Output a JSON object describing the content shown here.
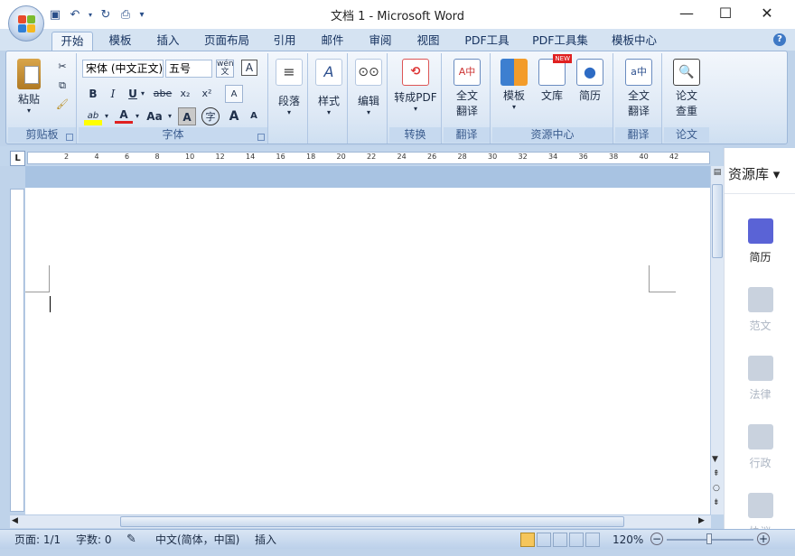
{
  "window": {
    "title": "文档 1 - Microsoft Word",
    "minimize": "—",
    "maximize": "☐",
    "close": "✕"
  },
  "tabs": [
    "开始",
    "模板",
    "插入",
    "页面布局",
    "引用",
    "邮件",
    "审阅",
    "视图",
    "PDF工具",
    "PDF工具集",
    "模板中心"
  ],
  "clipboard": {
    "paste": "粘贴",
    "group": "剪贴板"
  },
  "font": {
    "name": "宋体 (中文正文)",
    "size": "五号",
    "group": "字体",
    "bold": "B",
    "italic": "I",
    "underline": "U",
    "strike": "abe",
    "sub": "x₂",
    "sup": "x²",
    "grow": "A",
    "shrink": "A",
    "case": "Aa",
    "char_border": "A",
    "enclose": "字",
    "wen": "wén\n文",
    "clear": "A"
  },
  "paragraph": {
    "label": "段落"
  },
  "styles": {
    "label": "样式"
  },
  "editing": {
    "label": "编辑"
  },
  "convert": {
    "button": "转成PDF",
    "group": "转换"
  },
  "translate": {
    "button_line1": "全文",
    "button_line2": "翻译",
    "group": "翻译"
  },
  "resources": {
    "template": "模板",
    "library": "文库",
    "resume": "简历",
    "new_badge": "NEW",
    "group": "资源中心"
  },
  "translate2": {
    "button_line1": "全文",
    "button_line2": "翻译",
    "group": "翻译"
  },
  "paper": {
    "button_line1": "论文",
    "button_line2": "查重",
    "group": "论文"
  },
  "ruler": {
    "marks": [
      "2",
      "4",
      "6",
      "8",
      "10",
      "12",
      "14",
      "16",
      "18",
      "20",
      "22",
      "24",
      "26",
      "28",
      "30",
      "32",
      "34",
      "36",
      "38",
      "40",
      "42"
    ],
    "tab_stop": "L"
  },
  "side_panel": {
    "title": "资源库",
    "items": [
      "简历",
      "范文",
      "法律",
      "行政",
      "协议"
    ]
  },
  "status": {
    "page": "页面: 1/1",
    "words": "字数: 0",
    "language": "中文(简体，中国)",
    "mode": "插入",
    "zoom": "120%"
  },
  "colors": {
    "accent": "#3f79c5",
    "ribbon": "#dde8f5",
    "highlight": "#ffff00",
    "font_color": "#e02020",
    "side_icon_active": "#5a63d6"
  }
}
